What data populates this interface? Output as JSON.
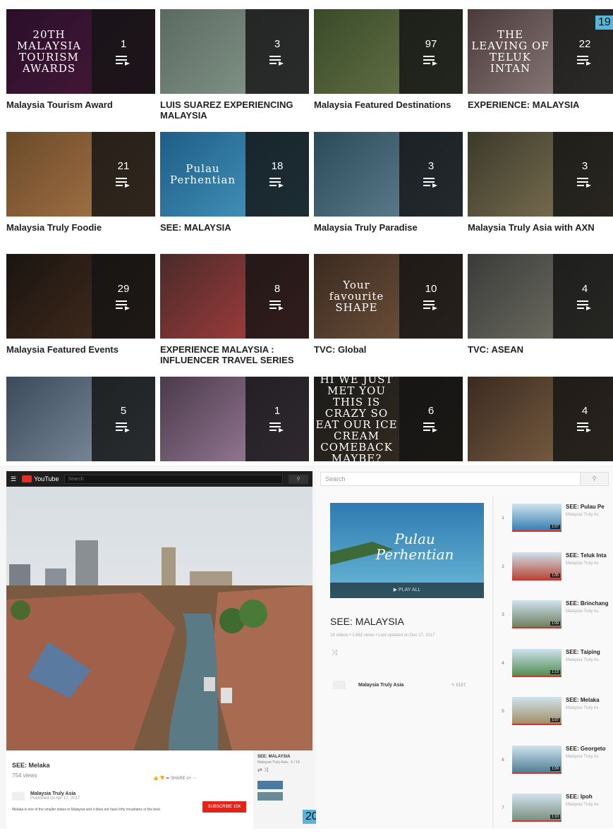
{
  "playlists": [
    {
      "title": "Malaysia Tourism Award",
      "count": "1",
      "thumb_text": "20TH MALAYSIA TOURISM AWARDS",
      "bg": [
        "#2a0f2a",
        "#4a1a3a"
      ]
    },
    {
      "title": "LUIS SUAREZ EXPERIENCING MALAYSIA",
      "count": "3",
      "thumb_text": "",
      "bg": [
        "#5a6a62",
        "#8c9d90"
      ]
    },
    {
      "title": "Malaysia Featured Destinations",
      "count": "97",
      "thumb_text": "",
      "bg": [
        "#3a4a2a",
        "#6b7a4a"
      ]
    },
    {
      "title": "EXPERIENCE: MALAYSIA",
      "count": "22",
      "thumb_text": "THE LEAVING OF TELUK INTAN",
      "bg": [
        "#4a3a3a",
        "#9a8a8a"
      ]
    },
    {
      "title": "Malaysia Truly Foodie",
      "count": "21",
      "thumb_text": "",
      "bg": [
        "#6a4a2a",
        "#b07a4a"
      ]
    },
    {
      "title": "SEE: MALAYSIA",
      "count": "18",
      "thumb_text": "Pulau Perhentian",
      "bg": [
        "#1f5d86",
        "#4aa0c8"
      ]
    },
    {
      "title": "Malaysia Truly Paradise",
      "count": "3",
      "thumb_text": "",
      "bg": [
        "#2a4a5a",
        "#6a8a9a"
      ]
    },
    {
      "title": "Malaysia Truly Asia with AXN",
      "count": "3",
      "thumb_text": "",
      "bg": [
        "#3a3a2a",
        "#8a7a5a"
      ]
    },
    {
      "title": "Malaysia Featured Events",
      "count": "29",
      "thumb_text": "",
      "bg": [
        "#1a1410",
        "#4a3020"
      ]
    },
    {
      "title": "EXPERIENCE MALAYSIA : INFLUENCER TRAVEL SERIES",
      "count": "8",
      "thumb_text": "",
      "bg": [
        "#4a2a2a",
        "#b84040"
      ]
    },
    {
      "title": "TVC: Global",
      "count": "10",
      "thumb_text": "Your favourite SHAPE",
      "bg": [
        "#3a2a20",
        "#7a5a40"
      ]
    },
    {
      "title": "TVC: ASEAN",
      "count": "4",
      "thumb_text": "",
      "bg": [
        "#3a3a3a",
        "#7a7a6a"
      ]
    },
    {
      "title": "",
      "count": "5",
      "thumb_text": "",
      "bg": [
        "#3a4a5a",
        "#8a9aaa"
      ]
    },
    {
      "title": "",
      "count": "1",
      "thumb_text": "",
      "bg": [
        "#4a3a4a",
        "#aa8aaa"
      ]
    },
    {
      "title": "",
      "count": "6",
      "thumb_text": "HI WE JUST MET YOU THIS IS CRAZY SO EAT OUR ICE CREAM COMEBACK MAYBE?",
      "bg": [
        "#1a1a1a",
        "#3a3020"
      ]
    },
    {
      "title": "",
      "count": "4",
      "thumb_text": "",
      "bg": [
        "#3a2a20",
        "#8a6a4a"
      ]
    }
  ],
  "badges": {
    "top": "19",
    "bottom": "20"
  },
  "player": {
    "logo": "YouTube",
    "search_placeholder": "Search",
    "video_title": "SEE: Melaka",
    "views": "754 views",
    "channel": "Malaysia Truly Asia",
    "published": "Published on Apr 17, 2017",
    "subscribe": "SUBSCRIBE 15K",
    "description": "Melaka is one of the smaller states in Malaysia and it does not have lofty mountains or the best",
    "side_playlist_title": "SEE: MALAYSIA",
    "side_playlist_sub": "Malaysia Truly Asia - 5 / 18"
  },
  "playlist_page": {
    "search_placeholder": "Search",
    "cover_text": "Pulau Perhentian",
    "play_all": "PLAY ALL",
    "title": "SEE: MALAYSIA",
    "meta": "18 videos • 2,662 views • Last updated on Dec 17, 2017",
    "owner": "Malaysia Truly Asia",
    "edit": "EDIT",
    "items": [
      {
        "num": "1",
        "title": "SEE: Pulau Pe",
        "sub": "Malaysia Truly As",
        "dur": "1:07"
      },
      {
        "num": "2",
        "title": "SEE: Teluk Inta",
        "sub": "Malaysia Truly As",
        "dur": "1:05"
      },
      {
        "num": "3",
        "title": "SEE: Brinchang",
        "sub": "Malaysia Truly As",
        "dur": "1:09"
      },
      {
        "num": "4",
        "title": "SEE: Taiping",
        "sub": "Malaysia Truly As",
        "dur": "1:13"
      },
      {
        "num": "5",
        "title": "SEE: Melaka",
        "sub": "Malaysia Truly As",
        "dur": "1:07"
      },
      {
        "num": "6",
        "title": "SEE: Georgeto",
        "sub": "Malaysia Truly As",
        "dur": "1:09"
      },
      {
        "num": "7",
        "title": "SEE: Ipoh",
        "sub": "Malaysia Truly As",
        "dur": "1:10"
      }
    ]
  }
}
